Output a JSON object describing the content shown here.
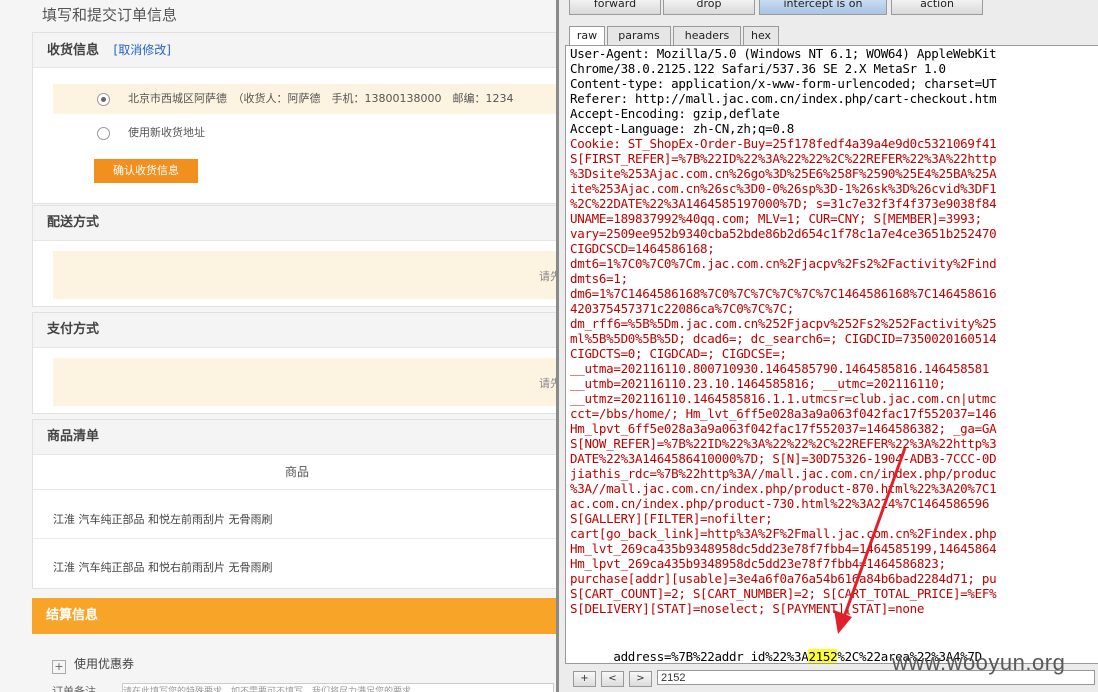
{
  "checkout": {
    "page_title": "填写和提交订单信息",
    "shipping": {
      "title": "收货信息",
      "cancel_link": "[取消修改]",
      "address_existing": "北京市西城区阿萨德　（收货人：阿萨德　手机：13800138000　邮编：1234",
      "address_new": "使用新收货地址",
      "confirm_button": "确认收货信息"
    },
    "delivery": {
      "title": "配送方式",
      "notice": "请先"
    },
    "payment": {
      "title": "支付方式",
      "notice": "请先"
    },
    "products": {
      "title": "商品清单",
      "column_header": "商品",
      "items": [
        "江淮 汽车纯正部品 和悦左前雨刮片 无骨雨刷",
        "江淮 汽车纯正部品 和悦右前雨刮片 无骨雨刷"
      ]
    },
    "settlement": {
      "title": "结算信息",
      "coupon_label": "使用优惠券",
      "note_label": "订单备注",
      "note_placeholder": "请在此填写您的特殊要求，如不需要可不填写，我们将尽力满足您的要求。"
    }
  },
  "burp": {
    "toolbar": [
      "forward",
      "drop",
      "intercept is on",
      "action"
    ],
    "tabs": [
      "raw",
      "params",
      "headers",
      "hex"
    ],
    "request_lines": [
      {
        "text": "User-Agent: Mozilla/5.0 (Windows NT 6.1; WOW64) AppleWebKit",
        "color": "black"
      },
      {
        "text": "Chrome/38.0.2125.122 Safari/537.36 SE 2.X MetaSr 1.0",
        "color": "black"
      },
      {
        "text": "Content-type: application/x-www-form-urlencoded; charset=UT",
        "color": "black"
      },
      {
        "text": "Referer: http://mall.jac.com.cn/index.php/cart-checkout.htm",
        "color": "black"
      },
      {
        "text": "Accept-Encoding: gzip,deflate",
        "color": "black"
      },
      {
        "text": "Accept-Language: zh-CN,zh;q=0.8",
        "color": "black"
      },
      {
        "text": "Cookie: ST_ShopEx-Order-Buy=25f178fedf4a39a4e9d0c5321069f41",
        "color": "red"
      },
      {
        "text": "S[FIRST_REFER]=%7B%22ID%22%3A%22%22%2C%22REFER%22%3A%22http",
        "color": "red"
      },
      {
        "text": "%3Dsite%253Ajac.com.cn%26go%3D%25E6%258F%2590%25E4%25BA%25A",
        "color": "red"
      },
      {
        "text": "ite%253Ajac.com.cn%26sc%3D0-0%26sp%3D-1%26sk%3D%26cvid%3DF1",
        "color": "red"
      },
      {
        "text": "%2C%22DATE%22%3A1464585197000%7D; s=31c7e32f3f4f373e9038f84",
        "color": "red"
      },
      {
        "text": "UNAME=189837992%40qq.com; MLV=1; CUR=CNY; S[MEMBER]=3993;",
        "color": "red"
      },
      {
        "text": "vary=2509ee952b9340cba52bde86b2d654c1f78c1a7e4ce3651b252470",
        "color": "red"
      },
      {
        "text": "CIGDCSCD=1464586168;",
        "color": "red"
      },
      {
        "text": "dmt6=1%7C0%7C0%7Cm.jac.com.cn%2Fjacpv%2Fs2%2Factivity%2Find",
        "color": "red"
      },
      {
        "text": "dmts6=1;",
        "color": "red"
      },
      {
        "text": "dm6=1%7C1464586168%7C0%7C%7C%7C%7C%7C1464586168%7C146458616",
        "color": "red"
      },
      {
        "text": "420375457371c22086ca%7C0%7C%7C;",
        "color": "red"
      },
      {
        "text": "dm_rff6=%5B%5Dm.jac.com.cn%252Fjacpv%252Fs2%252Factivity%25",
        "color": "red"
      },
      {
        "text": "ml%5B%5D0%5B%5D; dcad6=; dc_search6=; CIGDCID=7350020160514",
        "color": "red"
      },
      {
        "text": "CIGDCTS=0; CIGDCAD=; CIGDCSE=;",
        "color": "red"
      },
      {
        "text": "__utma=202116110.800710930.1464585790.1464585816.146458581",
        "color": "red"
      },
      {
        "text": "__utmb=202116110.23.10.1464585816; __utmc=202116110;",
        "color": "red"
      },
      {
        "text": "__utmz=202116110.1464585816.1.1.utmcsr=club.jac.com.cn|utmc",
        "color": "red"
      },
      {
        "text": "cct=/bbs/home/; Hm_lvt_6ff5e028a3a9a063f042fac17f552037=146",
        "color": "red"
      },
      {
        "text": "Hm_lpvt_6ff5e028a3a9a063f042fac17f552037=1464586382; _ga=GA",
        "color": "red"
      },
      {
        "text": "S[NOW_REFER]=%7B%22ID%22%3A%22%22%2C%22REFER%22%3A%22http%3",
        "color": "red"
      },
      {
        "text": "DATE%22%3A1464586410000%7D; S[N]=30D75326-1904-ADB3-7CCC-0D",
        "color": "red"
      },
      {
        "text": "jiathis_rdc=%7B%22http%3A//mall.jac.com.cn/index.php/produc",
        "color": "red"
      },
      {
        "text": "%3A//mall.jac.com.cn/index.php/product-870.html%22%3A20%7C1",
        "color": "red"
      },
      {
        "text": "ac.com.cn/index.php/product-730.html%22%3A224%7C1464586596",
        "color": "red"
      },
      {
        "text": "S[GALLERY][FILTER]=nofilter;",
        "color": "red"
      },
      {
        "text": "cart[go_back_link]=http%3A%2F%2Fmall.jac.com.cn%2Findex.php",
        "color": "red"
      },
      {
        "text": "Hm_lvt_269ca435b9348958dc5dd23e78f7fbb4=1464585199,14645864",
        "color": "red"
      },
      {
        "text": "Hm_lpvt_269ca435b9348958dc5dd23e78f7fbb4=1464586823;",
        "color": "red"
      },
      {
        "text": "purchase[addr][usable]=3e4a6f0a76a54b616a84b6bad2284d71; pu",
        "color": "red"
      },
      {
        "text": "S[CART_COUNT]=2; S[CART_NUMBER]=2; S[CART_TOTAL_PRICE]=%EF%",
        "color": "red"
      },
      {
        "text": "S[DELIVERY][STAT]=noselect; S[PAYMENT][STAT]=none",
        "color": "red"
      }
    ],
    "body": {
      "prefix": "address=%7B%22addr_id%22%3A",
      "highlight": "2152",
      "suffix": "%2C%22area%22%3A4%7D"
    },
    "search": {
      "buttons": [
        "+",
        "<",
        ">"
      ],
      "value": "2152"
    },
    "colors": {
      "red_text": "#c00000",
      "highlight": "#ffff30",
      "arrow": "#e0202a"
    }
  },
  "watermark": "www.wooyun.org"
}
